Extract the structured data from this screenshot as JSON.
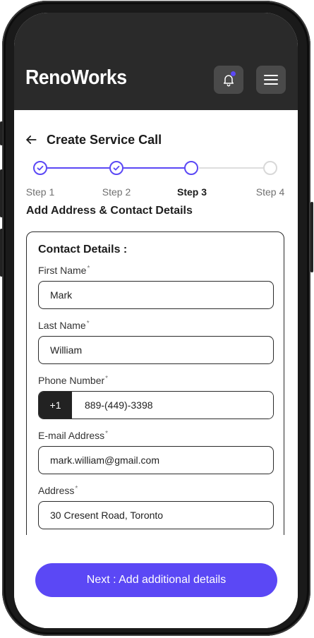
{
  "app": {
    "brand": "RenoWorks",
    "accent_color": "#5b48f5",
    "topbar_color": "#2a2a2a"
  },
  "header": {
    "title": "Create Service Call"
  },
  "stepper": {
    "current_step": 3,
    "steps": [
      {
        "label": "Step 1",
        "state": "complete"
      },
      {
        "label": "Step 2",
        "state": "complete"
      },
      {
        "label": "Step 3",
        "state": "current"
      },
      {
        "label": "Step 4",
        "state": "upcoming"
      }
    ]
  },
  "section_title": "Add Address & Contact Details",
  "contact": {
    "title": "Contact Details :",
    "first_name": {
      "label": "First Name",
      "required_mark": "*",
      "value": "Mark"
    },
    "last_name": {
      "label": "Last Name",
      "required_mark": "*",
      "value": "William"
    },
    "phone": {
      "label": "Phone Number",
      "required_mark": "*",
      "country_code": "+1",
      "value": "889-(449)-3398"
    },
    "email": {
      "label": "E-mail Address",
      "required_mark": "*",
      "value": "mark.william@gmail.com"
    },
    "address": {
      "label": "Address",
      "required_mark": "*",
      "value": "30 Cresent Road, Toronto"
    }
  },
  "footer": {
    "next_label": "Next : Add additional details"
  },
  "icons": {
    "back": "arrow-left-icon",
    "bell": "bell-icon",
    "menu": "hamburger-menu-icon",
    "check": "check-circle-icon"
  }
}
